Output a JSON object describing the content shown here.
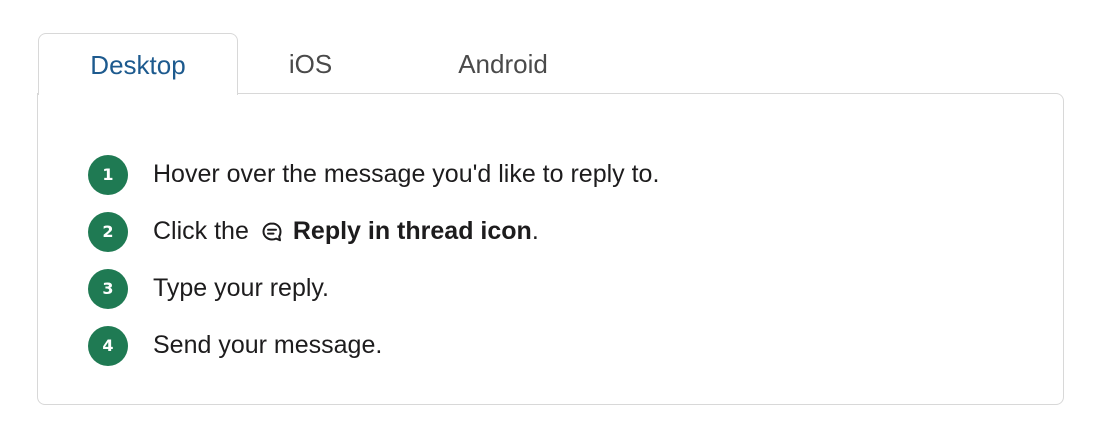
{
  "tabs": [
    {
      "label": "Desktop",
      "active": true
    },
    {
      "label": "iOS",
      "active": false
    },
    {
      "label": "Android",
      "active": false
    }
  ],
  "steps": [
    {
      "number": "1",
      "text": "Hover over the message you'd like to reply to."
    },
    {
      "number": "2",
      "prefix": "Click the",
      "icon": "reply-in-thread-icon",
      "bold": "Reply in thread icon",
      "suffix": "."
    },
    {
      "number": "3",
      "text": "Type your reply."
    },
    {
      "number": "4",
      "text": "Send your message."
    }
  ],
  "colors": {
    "accent": "#1f7a53",
    "active_tab": "#1d5a8e",
    "border": "#d8d8d8"
  }
}
